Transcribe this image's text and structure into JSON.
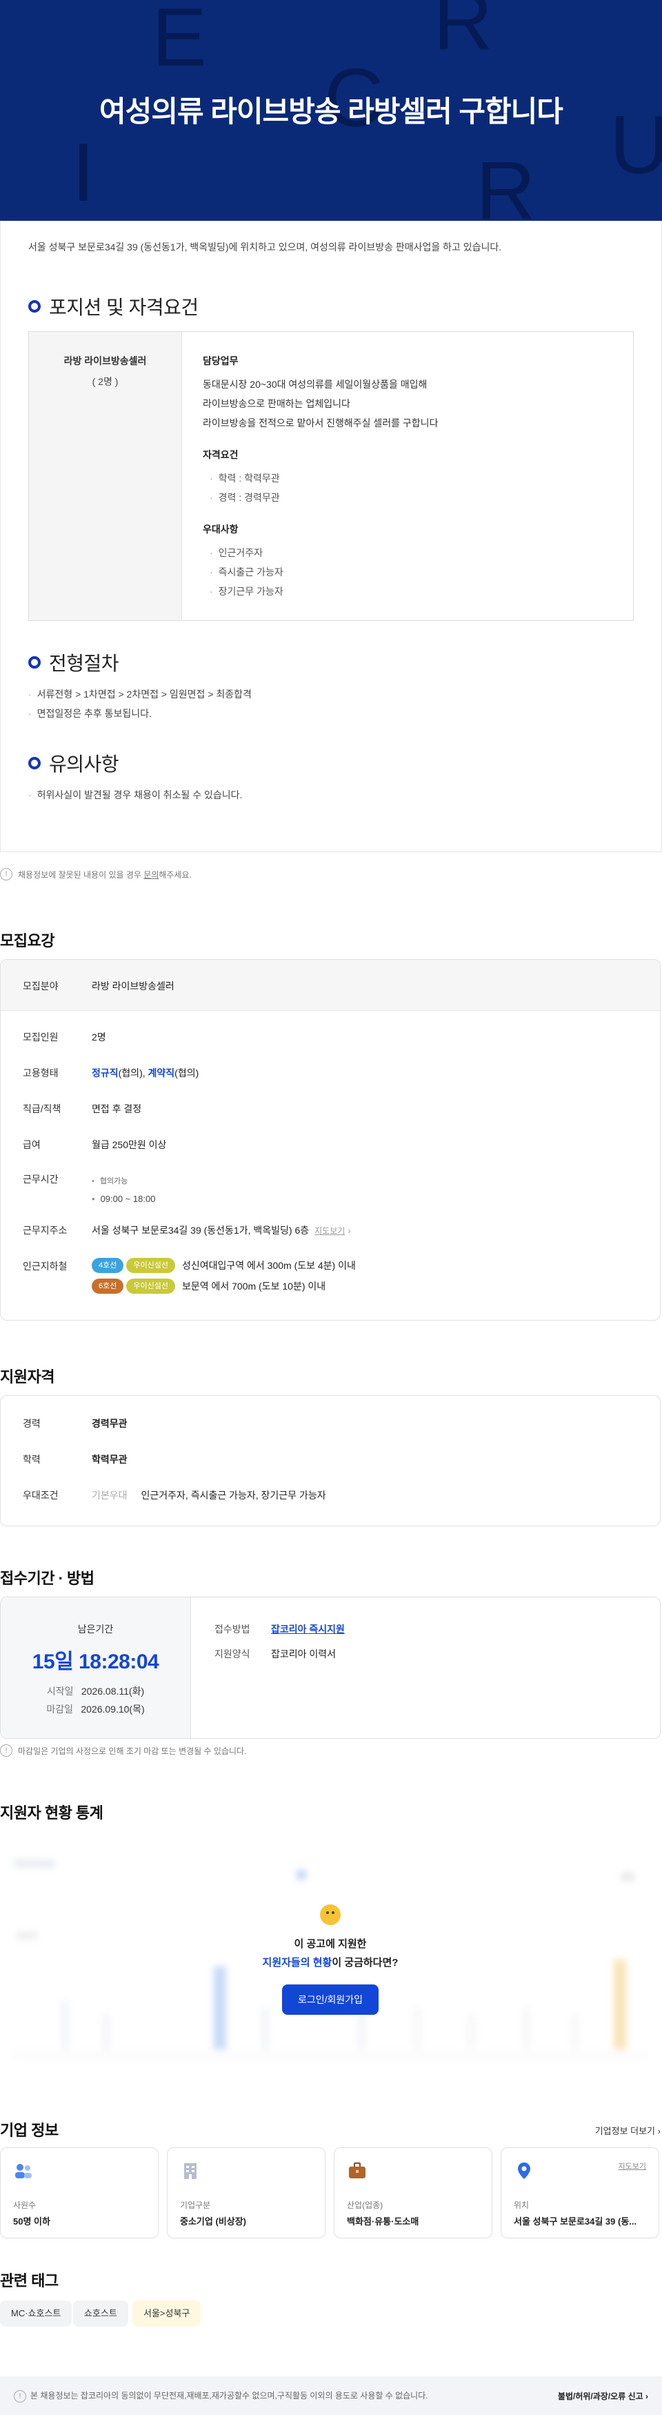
{
  "banner": {
    "title": "여성의류 라이브방송 라방셀러 구합니다",
    "ghost_letters": [
      "E",
      "R",
      "C",
      "I",
      "R",
      "U"
    ]
  },
  "detail": {
    "intro": "서울 성북구 보문로34길 39 (동선동1가, 백옥빌딩)에 위치하고 있으며, 여성의류 라이브방송 판매사업을 하고 있습니다.",
    "position_title": "포지션 및 자격요건",
    "position_name": "라방 라이브방송셀러",
    "position_count": "( 2명 )",
    "duty_heading": "담당업무",
    "duty_lines": [
      "동대문시장 20~30대 여성의류를 세일이월상품을 매입해",
      "라이브방송으로 판매하는 업체입니다",
      "라이브방송을 전적으로 맡아서 진행해주실 셀러를 구합니다"
    ],
    "qual_heading": "자격요건",
    "qual_items": [
      "학력 : 학력무관",
      "경력 : 경력무관"
    ],
    "pref_heading": "우대사항",
    "pref_items": [
      "인근거주자",
      "즉시출근 가능자",
      "장기근무 가능자"
    ],
    "process_title": "전형절차",
    "process_items": [
      "서류전형 > 1차면접 > 2차면접 > 임원면접 > 최종합격",
      "면접일정은 추후 통보됩니다."
    ],
    "caution_title": "유의사항",
    "caution_items": [
      "허위사실이 발견될 경우 채용이 취소될 수 있습니다."
    ]
  },
  "report_notice": {
    "text": "채용정보에 잘못된 내용이 있을 경우 ",
    "link": "문의",
    "suffix": "해주세요."
  },
  "recruit": {
    "heading": "모집요강",
    "field_label": "모집분야",
    "field_value": "라방 라이브방송셀러",
    "count_label": "모집인원",
    "count_value": "2명",
    "type_label": "고용형태",
    "type_a": "정규직",
    "type_a_note": "(협의), ",
    "type_b": "계약직",
    "type_b_note": "(협의)",
    "rank_label": "직급/직책",
    "rank_value": "면접 후 결정",
    "pay_label": "급여",
    "pay_value": "월급 250만원 이상",
    "hours_label": "근무시간",
    "hours_items": [
      "협의가능",
      "09:00 ~ 18:00"
    ],
    "addr_label": "근무지주소",
    "addr_value": "서울 성북구 보문로34길 39 (동선동1가, 백옥빌딩) 6층",
    "addr_map": "지도보기",
    "subway_label": "인근지하철",
    "subways": [
      {
        "line": "4호선",
        "line2": "우이신설선",
        "text": "성신여대입구역 에서 300m (도보 4분) 이내",
        "color": "#3aa3e0"
      },
      {
        "line": "6호선",
        "line2": "우이신설선",
        "text": "보문역 에서 700m (도보 10분) 이내",
        "color": "#c8702a"
      }
    ],
    "line2_color": "#c9c93a"
  },
  "qualification": {
    "heading": "지원자격",
    "exp_label": "경력",
    "exp_value": "경력무관",
    "edu_label": "학력",
    "edu_value": "학력무관",
    "pref_label": "우대조건",
    "pref_tag": "기본우대",
    "pref_value": "인근거주자, 즉시출근 가능자, 장기근무 가능자"
  },
  "period": {
    "heading": "접수기간 · 방법",
    "remain_label": "남은기간",
    "countdown": "15일 18:28:04",
    "start_label": "시작일",
    "start_value": "2026.08.11(화)",
    "end_label": "마감일",
    "end_value": "2026.09.10(목)",
    "method_label": "접수방법",
    "method_value": "잡코리아 즉시지원",
    "form_label": "지원양식",
    "form_value": "잡코리아 이력서",
    "notice": "마감일은 기업의 사정으로 인해 조기 마감 또는 변경될 수 있습니다."
  },
  "stats": {
    "heading": "지원자 현황 통계",
    "line1": "이 공고에 지원한",
    "line2_highlight": "지원자들의 현황",
    "line2_rest": "이 궁금하다면?",
    "login_button": "로그인/회원가입"
  },
  "company": {
    "heading": "기업 정보",
    "more": "기업정보 더보기",
    "cards": [
      {
        "label": "사원수",
        "value": "50명 이하",
        "icon": "people-icon"
      },
      {
        "label": "기업구분",
        "value": "중소기업 (비상장)",
        "icon": "building-icon"
      },
      {
        "label": "산업(업종)",
        "value": "백화점·유통·도소매",
        "icon": "briefcase-icon"
      },
      {
        "label": "위치",
        "value": "서울 성북구 보문로34길 39 (동...",
        "icon": "location-pin-icon",
        "map": "지도보기"
      }
    ]
  },
  "tags": {
    "heading": "관련 태그",
    "items": [
      "MC·쇼호스트",
      "쇼호스트",
      "서울>성북구"
    ]
  },
  "footer": {
    "text": "본 채용정보는 잡코리아의 동의없이 무단전재,재배포,재가공할수 없으며,구직활동 이외의 용도로 사용할 수 없습니다.",
    "report": "불법/허위/과장/오류 신고"
  },
  "colors": {
    "banner": "#0a2a78",
    "accent": "#1346d6",
    "ring": "#1535b6",
    "tag_highlight": "#fff8e0"
  }
}
